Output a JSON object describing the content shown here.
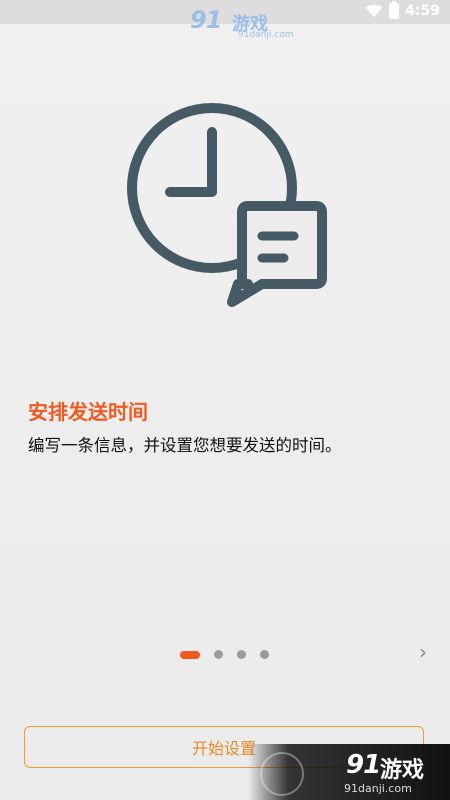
{
  "status_bar": {
    "time": "4:59",
    "icons": [
      "wifi-icon",
      "battery-icon"
    ]
  },
  "watermark": {
    "logo_text": "91",
    "title": "游戏",
    "url": "91danji.com"
  },
  "illustration": {
    "icon": "clock-with-message-icon",
    "color": "#455a64"
  },
  "intro": {
    "title": "安排发送时间",
    "description": "编写一条信息，并设置您想要发送的时间。"
  },
  "pager": {
    "total_pages": 4,
    "active_index": 0,
    "next_icon": "chevron-right-icon"
  },
  "actions": {
    "start_label": "开始设置"
  },
  "colors": {
    "accent": "#f05a1e",
    "button_border": "#f29b2e",
    "icon_stroke": "#455a64"
  }
}
